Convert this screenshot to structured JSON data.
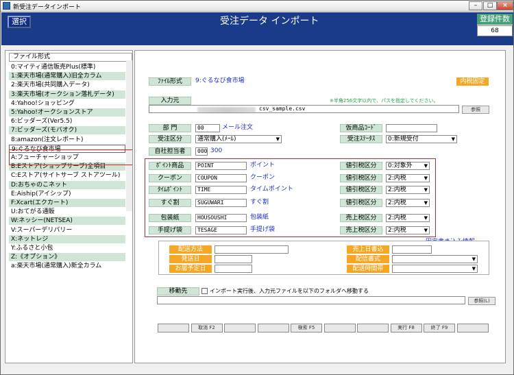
{
  "window": {
    "title": "新受注データインポート",
    "min": "–",
    "max": "□",
    "close": "×"
  },
  "topbar": {
    "select_label": "選択",
    "app_title": "受注データ インポート",
    "count_label": "登録件数",
    "count_value": "68"
  },
  "file_list": {
    "header": "ファイル形式",
    "items": [
      "0:マイティ通信販売Plus(標準)",
      "1:楽天市場(通常購入)旧全カラム",
      "2:楽天市場(共同購入データ)",
      "3:楽天市場(オークション落札データ)",
      "4:Yahoo!ショッピング",
      "5:Yahoo!オークションストア",
      "6:ビッダーズ(Ver5.5)",
      "7:ビッダーズ(モバオク)",
      "8:amazon(注文レポート)",
      "9:ぐるなび食市場",
      "A:フューチャーショップ",
      "B:Eストア(ショップサーブ)全項目",
      "C:Eストア(サイトサーブ ストアツール)",
      "D:おちゃのこネット",
      "E:Aiship(アイシップ)",
      "F:Xcart(エクカート)",
      "U:おてがる通販",
      "W:ネッシー(NETSEA)",
      "V:スーパーデリバリー",
      "X:ネットレジ",
      "Y:ふるさと小包",
      "Z:《オプション》",
      "a:楽天市場(通常購入)新全カラム"
    ],
    "selected_index": 9
  },
  "form": {
    "file_format_label": "ﾌｧｲﾙ形式",
    "file_format_value": "9:ぐるなび食市場",
    "tax_badge": "内税固定",
    "input_source_label": "入力元",
    "input_path": "csv_sample.csv",
    "path_note": "※半角256文字以内で、パスを指定してください。",
    "browse_label": "参照",
    "dept_label": "部 門",
    "dept_code": "00",
    "dept_name": "メール注文",
    "order_type_label": "受注区分",
    "order_type_value": "通常購入(ﾒｰﾙ)",
    "temp_code_label": "仮商品ｺｰﾄﾞ",
    "temp_code_value": "",
    "order_status_label": "受注ｽﾃｰﾀｽ",
    "order_status_value": "0:新規受付",
    "staff_label": "自社担当者",
    "staff_code": "000",
    "staff_name": "300",
    "discount_rows": [
      {
        "label": "ﾎﾟｲﾝﾄ商品",
        "code": "POINT",
        "name": "ポイント",
        "tax_label": "値引税区分",
        "tax_value": "0:対象外"
      },
      {
        "label": "クーポン",
        "code": "COUPON",
        "name": "クーポン",
        "tax_label": "値引税区分",
        "tax_value": "2:内税"
      },
      {
        "label": "ﾀｲﾑﾎﾟｲﾝﾄ",
        "code": "TIME",
        "name": "タイムポイント",
        "tax_label": "値引税区分",
        "tax_value": "2:内税"
      },
      {
        "label": "すぐ割",
        "code": "SUGUWARI",
        "name": "すぐ割",
        "tax_label": "値引税区分",
        "tax_value": "2:内税"
      },
      {
        "label": "包装紙",
        "code": "HOUSOUSHI",
        "name": "包装紙",
        "tax_label": "売上税区分",
        "tax_value": "2:内税"
      },
      {
        "label": "手提げ袋",
        "code": "TESAGE",
        "name": "手提げ袋",
        "tax_label": "売上税区分",
        "tax_value": "2:内税"
      }
    ],
    "fixed_info_link": "固定書き込み情報",
    "shipping_method_label": "配送方法",
    "ship_date_label": "発送日",
    "delivery_date_label": "お届予定日",
    "sales_date_label": "売上日書込",
    "delivery_form_label": "配信書式",
    "delivery_time_label": "配送時間帯",
    "move_label": "移動先",
    "move_checkbox_label": "インポート実行後、入力元ファイルを以下のフォルダへ移動する",
    "move_browse_label": "参照(L)"
  },
  "footer": {
    "buttons": [
      "",
      "取消 F2",
      "",
      "",
      "検索 F5",
      "",
      "",
      "実行 F8",
      "終了 F9",
      ""
    ]
  },
  "colors": {
    "topbar": "#1a3a8a",
    "label_green": "#cfe6d6",
    "orange": "#f5a623",
    "link_blue": "#1c2dbf",
    "highlight_red": "#d32424"
  }
}
